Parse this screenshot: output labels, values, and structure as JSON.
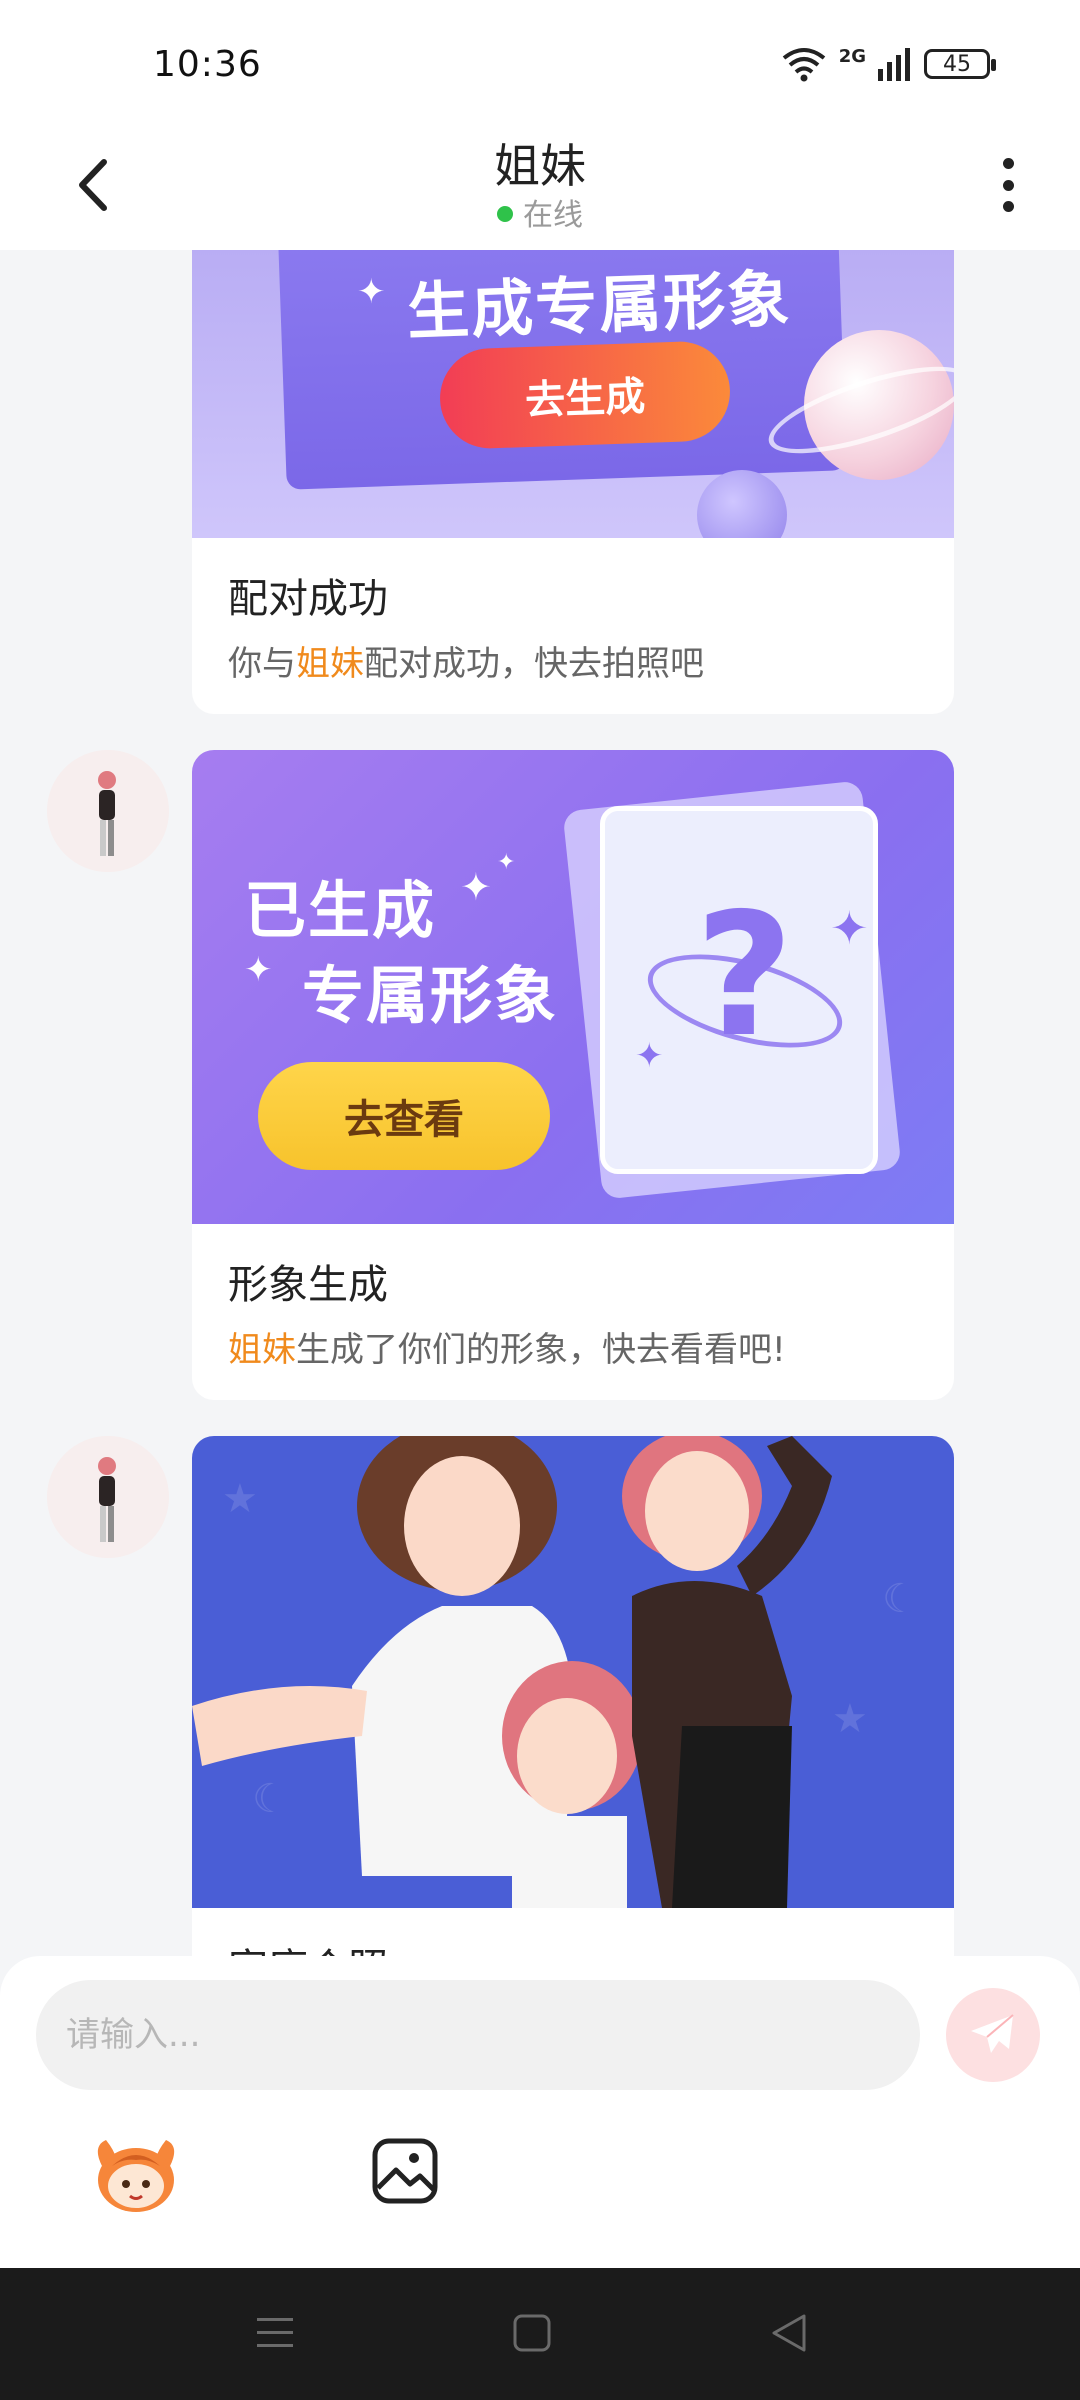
{
  "status_bar": {
    "time": "10:36",
    "network": "2G",
    "battery": "45"
  },
  "header": {
    "title": "姐妹",
    "status": "在线"
  },
  "messages": [
    {
      "banner": {
        "headline": "生成专属形象",
        "button": "去生成"
      },
      "title": "配对成功",
      "desc_prefix": "你与",
      "desc_highlight": "姐妹",
      "desc_suffix": "配对成功，快去拍照吧"
    },
    {
      "banner": {
        "line1": "已生成",
        "line2": "专属形象",
        "button": "去查看"
      },
      "title": "形象生成",
      "desc_highlight": "姐妹",
      "desc_suffix": "生成了你们的形象，快去看看吧!"
    },
    {
      "title": "家庭合照"
    }
  ],
  "input": {
    "placeholder": "请输入..."
  },
  "colors": {
    "accent": "#f08a1c",
    "online": "#2fc24a",
    "send_bg": "#fde0e1",
    "banner_purple": "#8a6ff0",
    "photo_bg": "#4a5ed6"
  }
}
